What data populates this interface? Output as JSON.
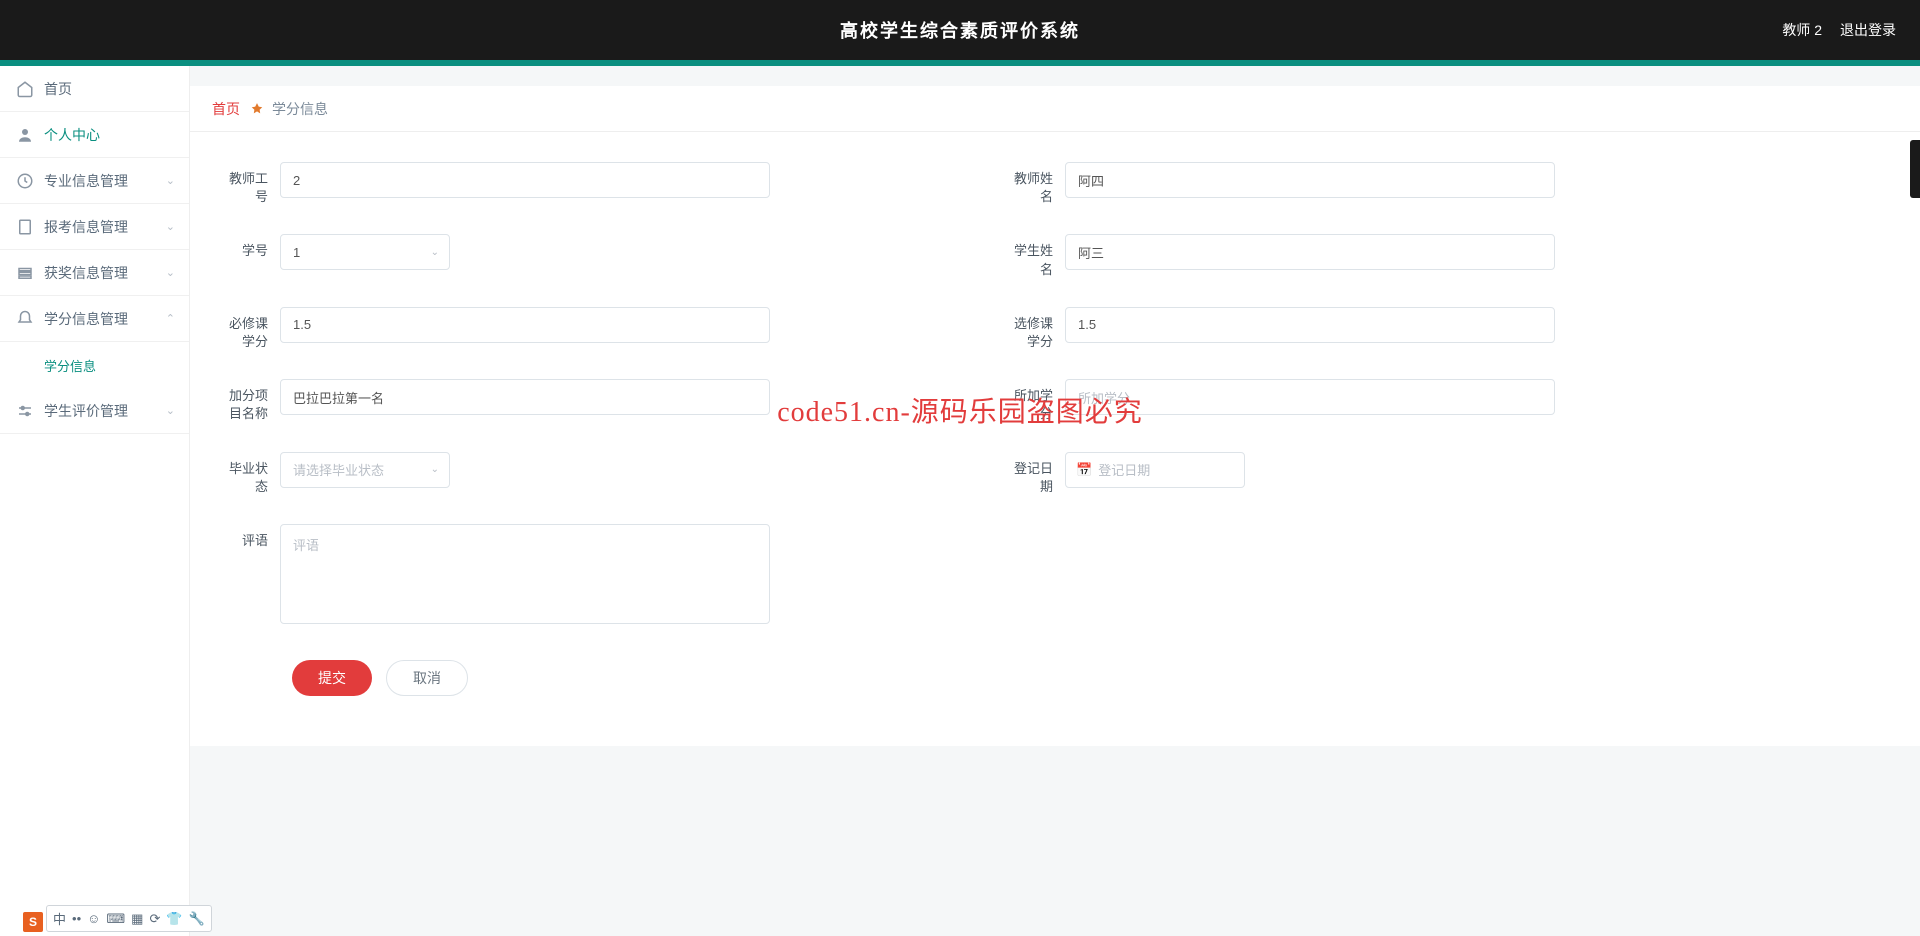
{
  "header": {
    "title": "高校学生综合素质评价系统",
    "user_label": "教师 2",
    "logout_label": "退出登录"
  },
  "sidebar": {
    "items": [
      {
        "label": "首页",
        "icon": "home",
        "expand": ""
      },
      {
        "label": "个人中心",
        "icon": "user",
        "expand": "",
        "active": true
      },
      {
        "label": "专业信息管理",
        "icon": "clock",
        "expand": "down"
      },
      {
        "label": "报考信息管理",
        "icon": "file",
        "expand": "down"
      },
      {
        "label": "获奖信息管理",
        "icon": "layers",
        "expand": "down"
      },
      {
        "label": "学分信息管理",
        "icon": "bell",
        "expand": "up",
        "open": true
      },
      {
        "label": "学生评价管理",
        "icon": "sliders",
        "expand": "down"
      }
    ],
    "sub_credit": "学分信息"
  },
  "breadcrumb": {
    "home": "首页",
    "current": "学分信息"
  },
  "form": {
    "teacher_no_label": "教师工号",
    "teacher_no_value": "2",
    "teacher_name_label": "教师姓名",
    "teacher_name_value": "阿四",
    "student_no_label": "学号",
    "student_no_value": "1",
    "student_name_label": "学生姓名",
    "student_name_value": "阿三",
    "required_credit_label": "必修课学分",
    "required_credit_value": "1.5",
    "elective_credit_label": "选修课学分",
    "elective_credit_value": "1.5",
    "bonus_name_label": "加分项目名称",
    "bonus_name_value": "巴拉巴拉第一名",
    "bonus_credit_label": "所加学分",
    "bonus_credit_placeholder": "所加学分",
    "grad_status_label": "毕业状态",
    "grad_status_placeholder": "请选择毕业状态",
    "reg_date_label": "登记日期",
    "reg_date_placeholder": "登记日期",
    "comment_label": "评语",
    "comment_placeholder": "评语",
    "submit": "提交",
    "cancel": "取消"
  },
  "watermark_center": "code51.cn-源码乐园盗图必究",
  "watermark_text": "code51.cn",
  "ime": {
    "badge": "S",
    "items": [
      "中",
      "••",
      "☺",
      "⌨",
      "▦",
      "⟳",
      "👕",
      "🔧"
    ]
  }
}
